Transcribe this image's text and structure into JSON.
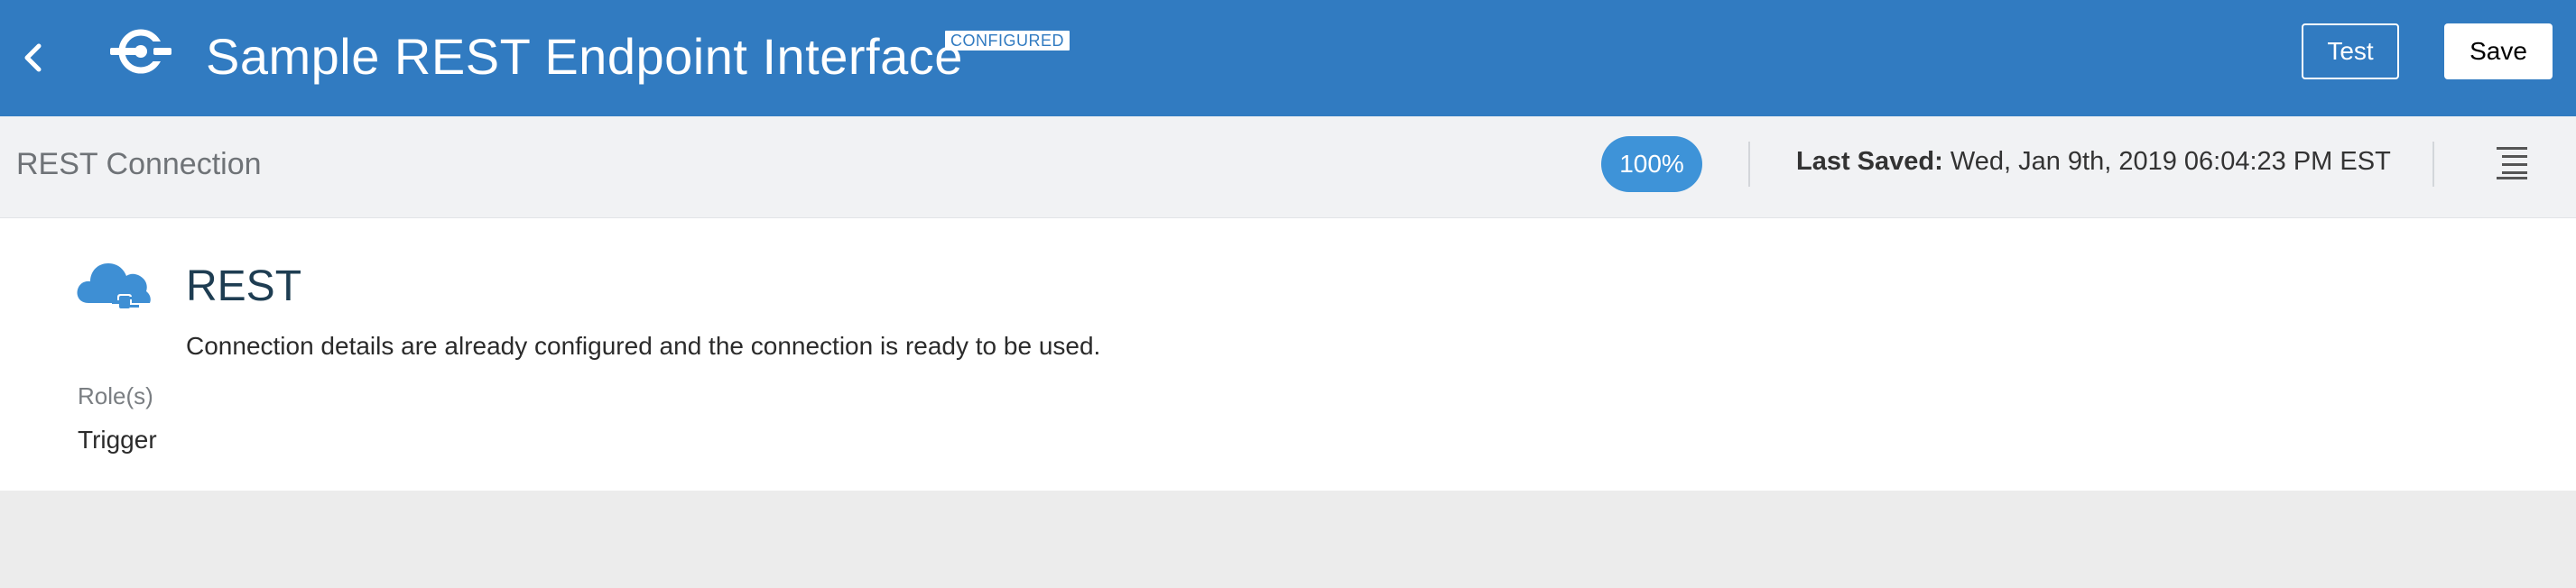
{
  "header": {
    "title": "Sample REST Endpoint Interface",
    "status_badge": "CONFIGURED",
    "test_label": "Test",
    "save_label": "Save",
    "back_icon": "chevron-left-icon",
    "logo_icon": "connection-logo-icon",
    "background_color": "#317bc1"
  },
  "subbar": {
    "section_title": "REST Connection",
    "progress": "100%",
    "last_saved_label": "Last Saved:",
    "last_saved_value": "Wed, Jan 9th, 2019 06:04:23 PM EST",
    "menu_icon": "list-menu-icon",
    "accent_color": "#3e93d8"
  },
  "connection": {
    "type_icon": "cloud-plug-icon",
    "heading": "REST",
    "description": "Connection details are already configured and the connection is ready to be used.",
    "roles_label": "Role(s)",
    "roles_value": "Trigger"
  }
}
